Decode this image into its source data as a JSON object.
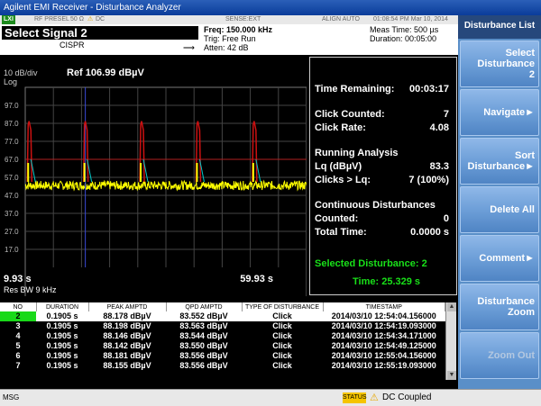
{
  "window": {
    "title": "Agilent EMI Receiver - Disturbance Analyzer"
  },
  "status_row": {
    "lxi": "LXI",
    "rf_presel": "RF PRESEL",
    "impedance": "50 Ω",
    "coupling": "DC",
    "sense": "SENSE:EXT",
    "align": "ALIGN AUTO",
    "datetime": "01:08:54 PM Mar 10, 2014"
  },
  "info": {
    "title": "Select Signal 2",
    "standard": "CISPR",
    "freq": "Freq: 150.000 kHz",
    "trig": "Trig: Free Run",
    "atten": "Atten: 42 dB",
    "meas_time": "Meas Time: 500 µs",
    "duration": "Duration: 00:05:00"
  },
  "plot": {
    "scale": "10 dB/div",
    "log": "Log",
    "ref": "Ref 106.99 dBµV",
    "start": "9.93 s",
    "stop": "59.93 s",
    "res_bw": "Res BW 9 kHz",
    "y_ticks": [
      "97.0",
      "87.0",
      "77.0",
      "67.0",
      "57.0",
      "47.0",
      "37.0",
      "27.0",
      "17.0"
    ],
    "colors": {
      "trace": "#ffff00",
      "clicks": "#cc1111",
      "limit": "#b02020",
      "marker": "#3b4bd8",
      "cyan": "#00c8c8"
    }
  },
  "chart_data": {
    "type": "line",
    "title": "",
    "xlabel": "",
    "ylabel": "",
    "ylim": [
      7,
      107
    ],
    "xlim": [
      9.93,
      59.93
    ],
    "limit_line": 67,
    "baseline": 52.5,
    "click_times": [
      10.93,
      20.93,
      30.93,
      40.93,
      50.93
    ],
    "click_peak": 88.2,
    "marker_x": 20.93,
    "grid": true
  },
  "panel": {
    "time_remaining_label": "Time Remaining:",
    "time_remaining": "00:03:17",
    "click_counted_label": "Click Counted:",
    "click_counted": "7",
    "click_rate_label": "Click Rate:",
    "click_rate": "4.08",
    "running_analysis": "Running Analysis",
    "lq_label": "Lq   (dBµV)",
    "lq": "83.3",
    "clicks_lq_label": "Clicks > Lq:",
    "clicks_lq": "7 (100%)",
    "continuous": "Continuous Disturbances",
    "counted_label": "Counted:",
    "counted": "0",
    "total_time_label": "Total Time:",
    "total_time": "0.0000 s",
    "selected": "Selected Disturbance: 2",
    "time_label": "Time:",
    "time": "25.329 s"
  },
  "table": {
    "headers": [
      "NO",
      "DURATION",
      "PEAK AMPTD",
      "QPD AMPTD",
      "TYPE OF DISTURBANCE",
      "TIMESTAMP"
    ],
    "rows": [
      [
        "2",
        "0.1905 s",
        "88.178 dBµV",
        "83.552 dBµV",
        "Click",
        "2014/03/10 12:54:04.156000"
      ],
      [
        "3",
        "0.1905 s",
        "88.198 dBµV",
        "83.563 dBµV",
        "Click",
        "2014/03/10 12:54:19.093000"
      ],
      [
        "4",
        "0.1905 s",
        "88.146 dBµV",
        "83.544 dBµV",
        "Click",
        "2014/03/10 12:54:34.171000"
      ],
      [
        "5",
        "0.1905 s",
        "88.142 dBµV",
        "83.550 dBµV",
        "Click",
        "2014/03/10 12:54:49.125000"
      ],
      [
        "6",
        "0.1905 s",
        "88.181 dBµV",
        "83.556 dBµV",
        "Click",
        "2014/03/10 12:55:04.156000"
      ],
      [
        "7",
        "0.1905 s",
        "88.155 dBµV",
        "83.556 dBµV",
        "Click",
        "2014/03/10 12:55:19.093000"
      ]
    ]
  },
  "bottom": {
    "msg": "MSG",
    "status": "STATUS",
    "dc_coupled": "DC Coupled"
  },
  "softkeys": {
    "title": "Disturbance List",
    "select_line1": "Select",
    "select_line2": "Disturbance",
    "select_line3": "2",
    "navigate": "Navigate",
    "sort_line1": "Sort",
    "sort_line2": "Disturbance",
    "delete_all": "Delete All",
    "comment": "Comment",
    "zoom_line1": "Disturbance",
    "zoom_line2": "Zoom",
    "zoom_out": "Zoom Out"
  }
}
